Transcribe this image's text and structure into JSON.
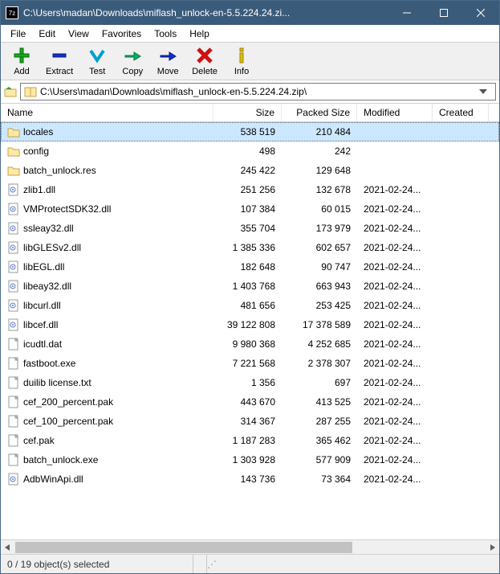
{
  "window": {
    "title": "C:\\Users\\madan\\Downloads\\miflash_unlock-en-5.5.224.24.zi..."
  },
  "menu": {
    "items": [
      "File",
      "Edit",
      "View",
      "Favorites",
      "Tools",
      "Help"
    ]
  },
  "toolbar": {
    "buttons": [
      {
        "id": "add",
        "label": "Add"
      },
      {
        "id": "extract",
        "label": "Extract"
      },
      {
        "id": "test",
        "label": "Test"
      },
      {
        "id": "copy",
        "label": "Copy"
      },
      {
        "id": "move",
        "label": "Move"
      },
      {
        "id": "delete",
        "label": "Delete"
      },
      {
        "id": "info",
        "label": "Info"
      }
    ]
  },
  "address": {
    "path": "C:\\Users\\madan\\Downloads\\miflash_unlock-en-5.5.224.24.zip\\"
  },
  "columns": {
    "name": "Name",
    "size": "Size",
    "packed": "Packed Size",
    "modified": "Modified",
    "created": "Created"
  },
  "files": [
    {
      "icon": "folder2",
      "name": "locales",
      "size": "538 519",
      "packed": "210 484",
      "modified": "",
      "selected": true
    },
    {
      "icon": "folder2",
      "name": "config",
      "size": "498",
      "packed": "242",
      "modified": ""
    },
    {
      "icon": "folder2",
      "name": "batch_unlock.res",
      "size": "245 422",
      "packed": "129 648",
      "modified": ""
    },
    {
      "icon": "dll",
      "name": "zlib1.dll",
      "size": "251 256",
      "packed": "132 678",
      "modified": "2021-02-24..."
    },
    {
      "icon": "dll",
      "name": "VMProtectSDK32.dll",
      "size": "107 384",
      "packed": "60 015",
      "modified": "2021-02-24..."
    },
    {
      "icon": "dll",
      "name": "ssleay32.dll",
      "size": "355 704",
      "packed": "173 979",
      "modified": "2021-02-24..."
    },
    {
      "icon": "dll",
      "name": "libGLESv2.dll",
      "size": "1 385 336",
      "packed": "602 657",
      "modified": "2021-02-24..."
    },
    {
      "icon": "dll",
      "name": "libEGL.dll",
      "size": "182 648",
      "packed": "90 747",
      "modified": "2021-02-24..."
    },
    {
      "icon": "dll",
      "name": "libeay32.dll",
      "size": "1 403 768",
      "packed": "663 943",
      "modified": "2021-02-24..."
    },
    {
      "icon": "dll",
      "name": "libcurl.dll",
      "size": "481 656",
      "packed": "253 425",
      "modified": "2021-02-24..."
    },
    {
      "icon": "dll",
      "name": "libcef.dll",
      "size": "39 122 808",
      "packed": "17 378 589",
      "modified": "2021-02-24..."
    },
    {
      "icon": "file",
      "name": "icudtl.dat",
      "size": "9 980 368",
      "packed": "4 252 685",
      "modified": "2021-02-24..."
    },
    {
      "icon": "file",
      "name": "fastboot.exe",
      "size": "7 221 568",
      "packed": "2 378 307",
      "modified": "2021-02-24..."
    },
    {
      "icon": "file",
      "name": "duilib license.txt",
      "size": "1 356",
      "packed": "697",
      "modified": "2021-02-24..."
    },
    {
      "icon": "file",
      "name": "cef_200_percent.pak",
      "size": "443 670",
      "packed": "413 525",
      "modified": "2021-02-24..."
    },
    {
      "icon": "file",
      "name": "cef_100_percent.pak",
      "size": "314 367",
      "packed": "287 255",
      "modified": "2021-02-24..."
    },
    {
      "icon": "file",
      "name": "cef.pak",
      "size": "1 187 283",
      "packed": "365 462",
      "modified": "2021-02-24..."
    },
    {
      "icon": "file",
      "name": "batch_unlock.exe",
      "size": "1 303 928",
      "packed": "577 909",
      "modified": "2021-02-24..."
    },
    {
      "icon": "dll",
      "name": "AdbWinApi.dll",
      "size": "143 736",
      "packed": "73 364",
      "modified": "2021-02-24..."
    }
  ],
  "status": {
    "selection": "0 / 19 object(s) selected"
  }
}
